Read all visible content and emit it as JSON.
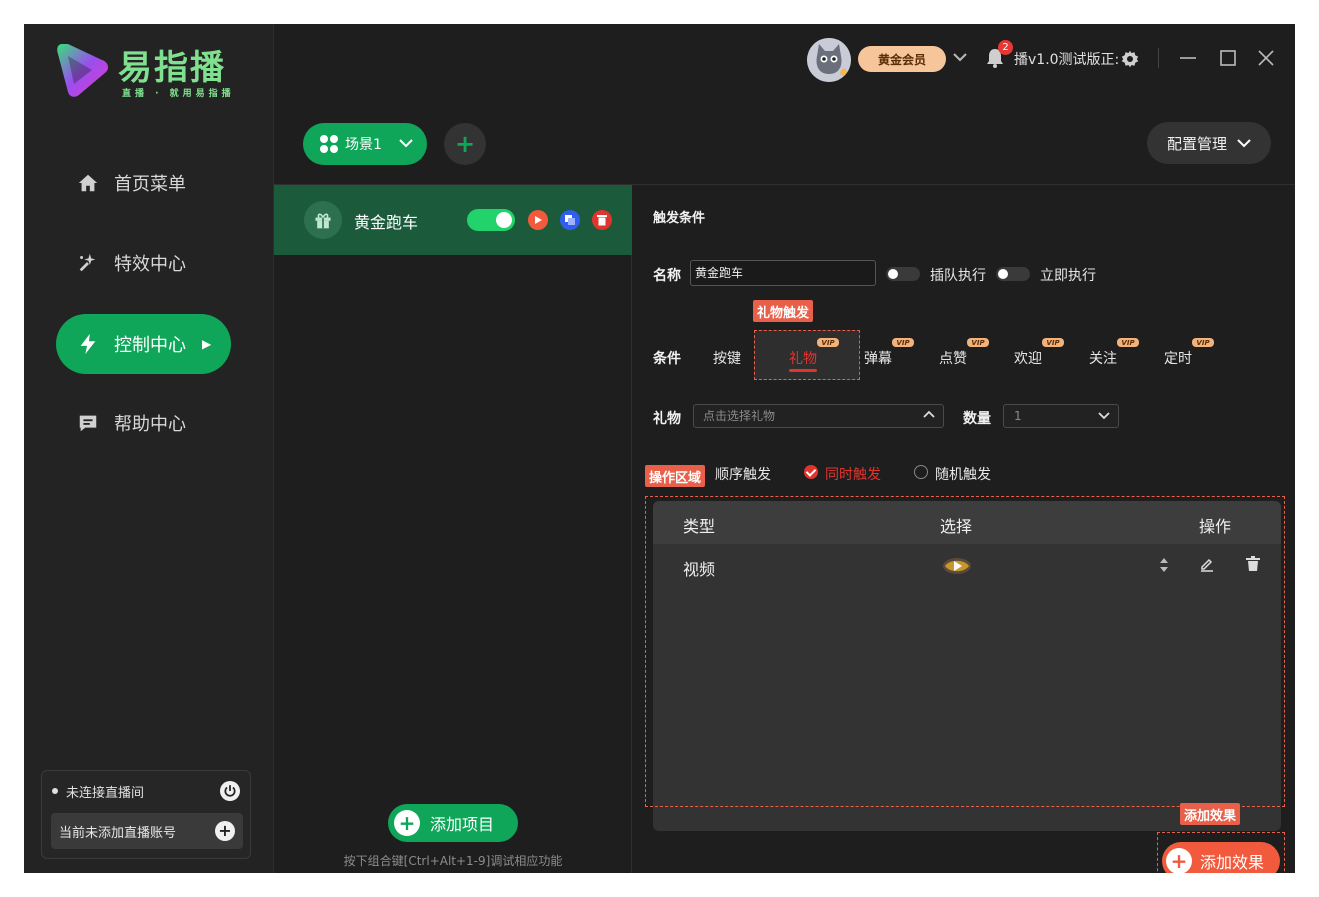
{
  "app": {
    "name": "易指播",
    "slogan": "直播 · 就用易指播"
  },
  "colors": {
    "accent": "#10a65a",
    "danger": "#e0352f",
    "orange": "#f25a3e",
    "gold": "#f6c59a"
  },
  "sidebar": {
    "items": [
      {
        "label": "首页菜单",
        "icon": "home-icon"
      },
      {
        "label": "特效中心",
        "icon": "sparkle-icon"
      },
      {
        "label": "控制中心",
        "icon": "lightning-icon",
        "active": true
      },
      {
        "label": "帮助中心",
        "icon": "chat-icon"
      }
    ],
    "status": {
      "connection": "未连接直播间",
      "account": "当前未添加直播账号"
    }
  },
  "header": {
    "member_badge": "黄金会员",
    "notification_count": "2",
    "version": "播v1.0测试版正:"
  },
  "toolbar": {
    "scene_label": "场景1",
    "add_scene": "+",
    "config_label": "配置管理"
  },
  "projects": {
    "items": [
      {
        "name": "黄金跑车",
        "enabled": true
      }
    ],
    "add_label": "添加项目",
    "hint": "按下组合键[Ctrl+Alt+1-9]调试相应功能"
  },
  "detail": {
    "trigger_title": "触发条件",
    "name_label": "名称",
    "name_value": "黄金跑车",
    "queue_label": "插队执行",
    "immediate_label": "立即执行",
    "condition_label": "条件",
    "conditions": [
      {
        "label": "按键",
        "vip": false
      },
      {
        "label": "礼物",
        "vip": true,
        "active": true
      },
      {
        "label": "弹幕",
        "vip": true
      },
      {
        "label": "点赞",
        "vip": true
      },
      {
        "label": "欢迎",
        "vip": true
      },
      {
        "label": "关注",
        "vip": true
      },
      {
        "label": "定时",
        "vip": true
      }
    ],
    "vip_text": "VIP",
    "gift_label": "礼物",
    "gift_placeholder": "点击选择礼物",
    "qty_label": "数量",
    "qty_value": "1",
    "trigger_modes": [
      {
        "label": "顺序触发",
        "checked": false
      },
      {
        "label": "同时触发",
        "checked": true
      },
      {
        "label": "随机触发",
        "checked": false
      }
    ],
    "table": {
      "headers": [
        "类型",
        "选择",
        "操作"
      ],
      "rows": [
        {
          "type": "视频",
          "selection": "video-thumb-icon"
        }
      ]
    },
    "add_effect": "添加效果"
  },
  "annotations": {
    "gift_trigger": "礼物触发",
    "op_area": "操作区域",
    "add_effect": "添加效果"
  }
}
